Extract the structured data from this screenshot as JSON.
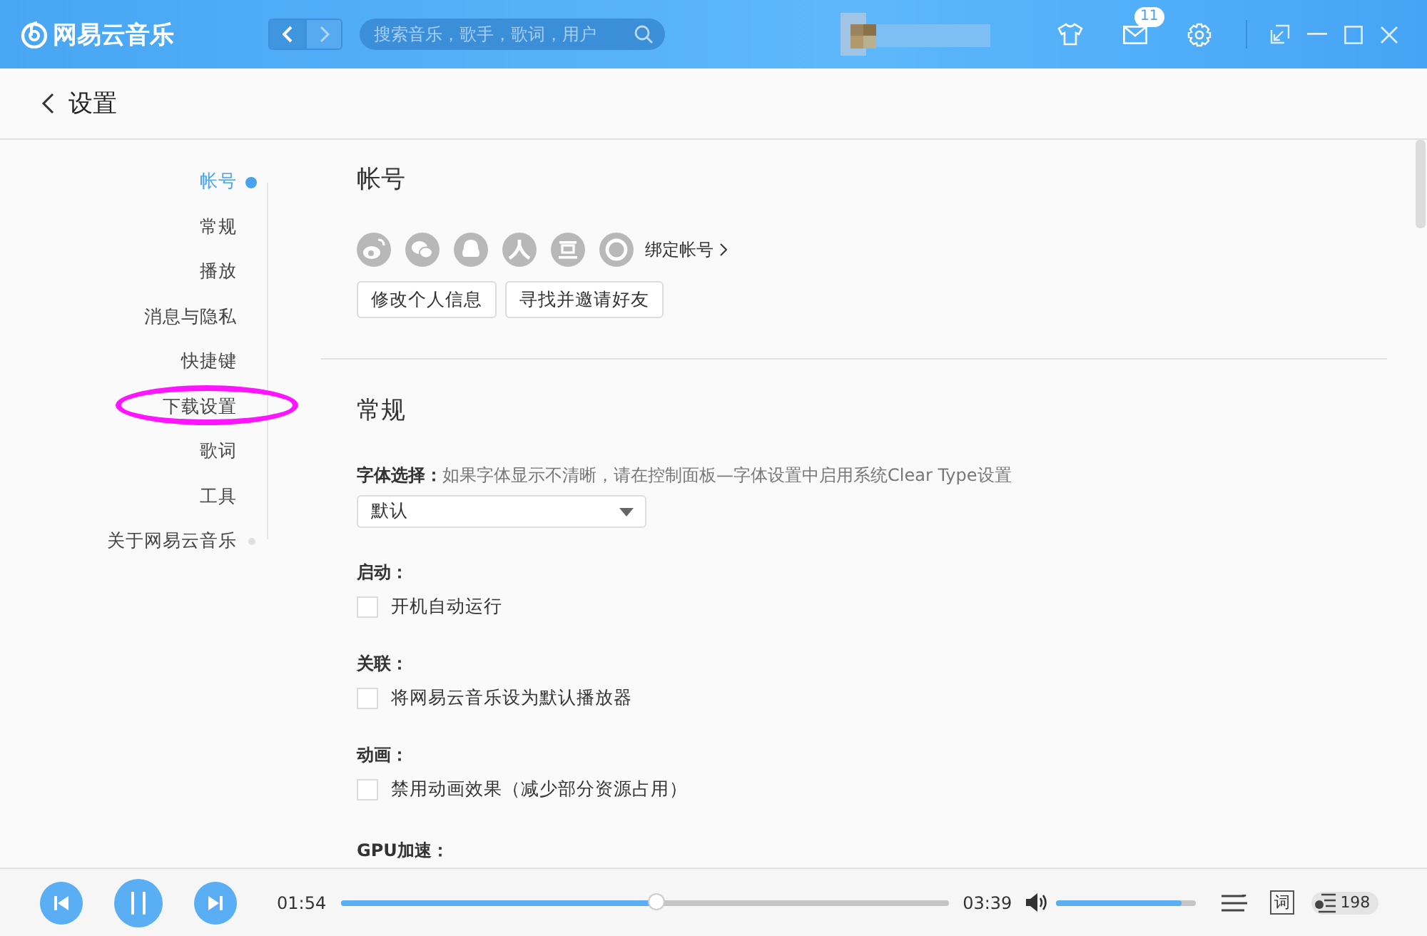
{
  "app": {
    "name": "网易云音乐"
  },
  "search": {
    "placeholder": "搜索音乐，歌手，歌词，用户"
  },
  "messages": {
    "badge": "11"
  },
  "page": {
    "title": "设置"
  },
  "sidebar": {
    "items": [
      {
        "label": "帐号",
        "selected": true,
        "annotated": false
      },
      {
        "label": "常规",
        "selected": false,
        "annotated": false
      },
      {
        "label": "播放",
        "selected": false,
        "annotated": false
      },
      {
        "label": "消息与隐私",
        "selected": false,
        "annotated": false
      },
      {
        "label": "快捷键",
        "selected": false,
        "annotated": false
      },
      {
        "label": "下载设置",
        "selected": false,
        "annotated": true
      },
      {
        "label": "歌词",
        "selected": false,
        "annotated": false
      },
      {
        "label": "工具",
        "selected": false,
        "annotated": false
      },
      {
        "label": "关于网易云音乐",
        "selected": false,
        "annotated": false
      }
    ]
  },
  "account": {
    "title": "帐号",
    "bind_link": "绑定帐号",
    "buttons": [
      "修改个人信息",
      "寻找并邀请好友"
    ]
  },
  "general": {
    "title": "常规",
    "font": {
      "label": "字体选择：",
      "hint": "如果字体显示不清晰，请在控制面板—字体设置中启用系统Clear Type设置",
      "value": "默认"
    },
    "groups": [
      {
        "label": "启动：",
        "option": "开机自动运行",
        "checked": false
      },
      {
        "label": "关联：",
        "option": "将网易云音乐设为默认播放器",
        "checked": false
      },
      {
        "label": "动画：",
        "option": "禁用动画效果（减少部分资源占用）",
        "checked": false
      }
    ],
    "next_label": "GPU加速："
  },
  "player": {
    "elapsed": "01:54",
    "duration": "03:39",
    "level": 0.52,
    "volume": {
      "level": 0.9
    },
    "lyrics_button": "词",
    "playlist_count": "198"
  }
}
